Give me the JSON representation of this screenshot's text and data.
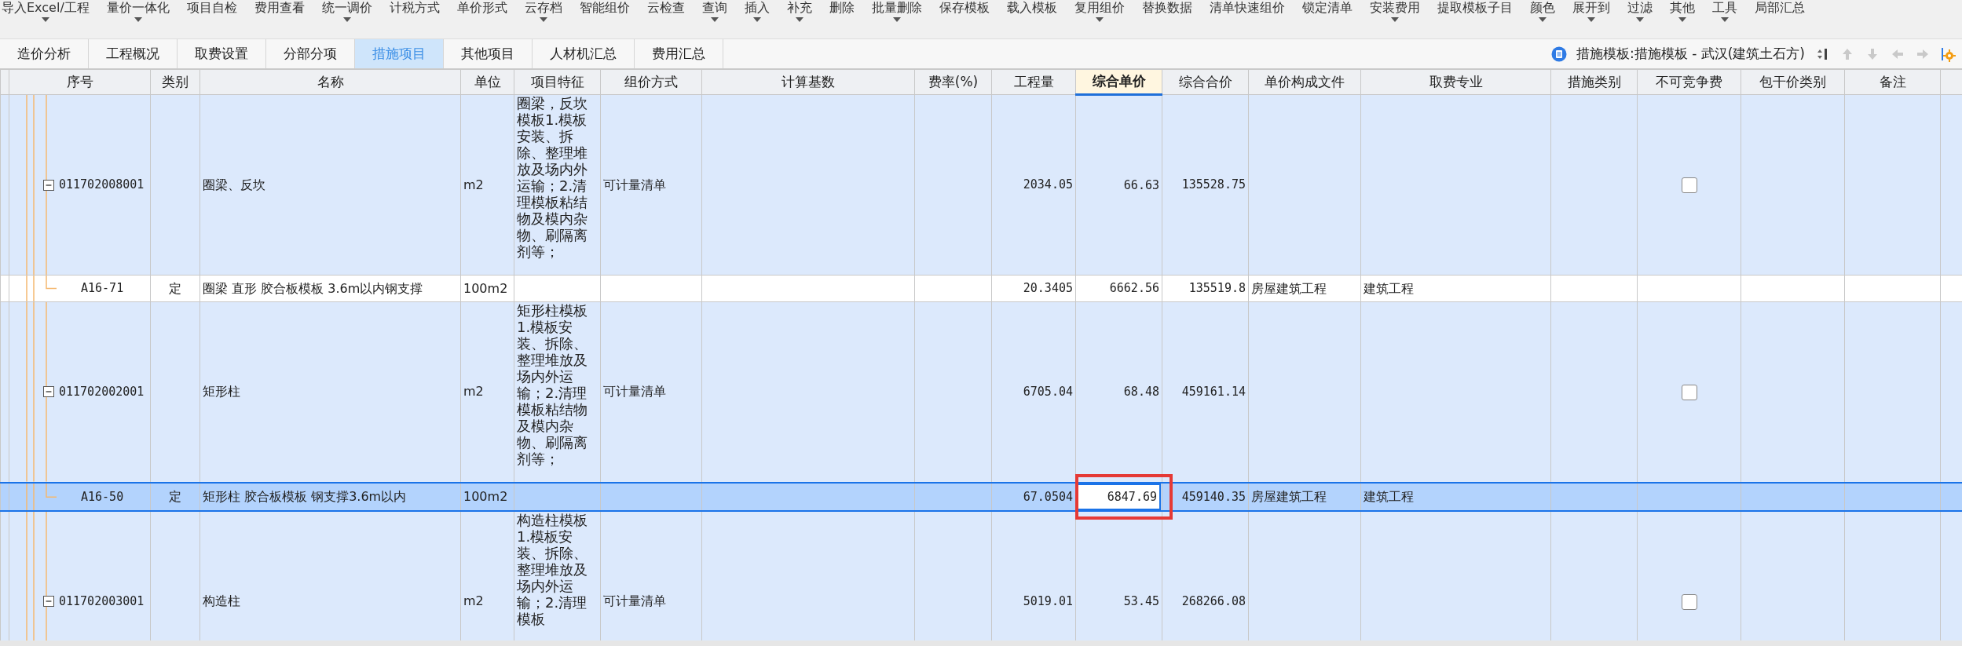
{
  "toolbar": [
    {
      "label": "导入Excel/工程",
      "dropdown": true
    },
    {
      "label": "量价一体化",
      "dropdown": true
    },
    {
      "label": "项目自检",
      "dropdown": false
    },
    {
      "label": "费用查看",
      "dropdown": false
    },
    {
      "label": "统一调价",
      "dropdown": true
    },
    {
      "label": "计税方式",
      "dropdown": false
    },
    {
      "label": "单价形式",
      "dropdown": false
    },
    {
      "label": "云存档",
      "dropdown": true
    },
    {
      "label": "智能组价",
      "dropdown": false
    },
    {
      "label": "云检查",
      "dropdown": false
    },
    {
      "label": "查询",
      "dropdown": true
    },
    {
      "label": "插入",
      "dropdown": true
    },
    {
      "label": "补充",
      "dropdown": true
    },
    {
      "label": "删除",
      "dropdown": false
    },
    {
      "label": "批量删除",
      "dropdown": true
    },
    {
      "label": "保存模板",
      "dropdown": false
    },
    {
      "label": "载入模板",
      "dropdown": false
    },
    {
      "label": "复用组价",
      "dropdown": true
    },
    {
      "label": "替换数据",
      "dropdown": false
    },
    {
      "label": "清单快速组价",
      "dropdown": false
    },
    {
      "label": "锁定清单",
      "dropdown": false
    },
    {
      "label": "安装费用",
      "dropdown": true
    },
    {
      "label": "提取模板子目",
      "dropdown": false
    },
    {
      "label": "颜色",
      "dropdown": true
    },
    {
      "label": "展开到",
      "dropdown": true
    },
    {
      "label": "过滤",
      "dropdown": true
    },
    {
      "label": "其他",
      "dropdown": true
    },
    {
      "label": "工具",
      "dropdown": true
    },
    {
      "label": "局部汇总",
      "dropdown": false
    }
  ],
  "tabs": [
    {
      "label": "造价分析",
      "selected": false
    },
    {
      "label": "工程概况",
      "selected": false
    },
    {
      "label": "取费设置",
      "selected": false
    },
    {
      "label": "分部分项",
      "selected": false
    },
    {
      "label": "措施项目",
      "selected": true
    },
    {
      "label": "其他项目",
      "selected": false
    },
    {
      "label": "人材机汇总",
      "selected": false
    },
    {
      "label": "费用汇总",
      "selected": false
    }
  ],
  "template": {
    "label": "措施模板:措施模板 - 武汉(建筑土石方)"
  },
  "table": {
    "columns": [
      {
        "label": "序号",
        "selected": false
      },
      {
        "label": "类别",
        "selected": false
      },
      {
        "label": "名称",
        "selected": false
      },
      {
        "label": "单位",
        "selected": false
      },
      {
        "label": "项目特征",
        "selected": false
      },
      {
        "label": "组价方式",
        "selected": false
      },
      {
        "label": "计算基数",
        "selected": false
      },
      {
        "label": "费率(%)",
        "selected": false
      },
      {
        "label": "工程量",
        "selected": false
      },
      {
        "label": "综合单价",
        "selected": true
      },
      {
        "label": "综合合价",
        "selected": false
      },
      {
        "label": "单价构成文件",
        "selected": false
      },
      {
        "label": "取费专业",
        "selected": false
      },
      {
        "label": "措施类别",
        "selected": false
      },
      {
        "label": "不可竞争费",
        "selected": false
      },
      {
        "label": "包干价类别",
        "selected": false
      },
      {
        "label": "备注",
        "selected": false
      }
    ],
    "rows": [
      {
        "kind": "list",
        "expanded": true,
        "selected": false,
        "code": "011702008001",
        "name": "圈梁、反坎",
        "unit": "m2",
        "features": "圈梁，反坎模板1.模板安装、拆除、整理堆放及场内外运输；2.清理模板粘结物及模内杂物、刷隔离剂等；",
        "method": "可计量清单",
        "quantity": "2034.05",
        "unit_price": "66.63",
        "total": "135528.75",
        "non_competitive": false
      },
      {
        "kind": "item",
        "selected": false,
        "code": "A16-71",
        "category": "定",
        "name": "圈梁 直形 胶合板模板 3.6m以内钢支撑",
        "unit": "100m2",
        "quantity": "20.3405",
        "unit_price": "6662.56",
        "total": "135519.8",
        "price_file": "房屋建筑工程",
        "fee_major": "建筑工程"
      },
      {
        "kind": "list",
        "expanded": true,
        "selected": false,
        "code": "011702002001",
        "name": "矩形柱",
        "unit": "m2",
        "features": "矩形柱模板1.模板安装、拆除、整理堆放及场内外运输；2.清理模板粘结物及模内杂物、刷隔离剂等；",
        "method": "可计量清单",
        "quantity": "6705.04",
        "unit_price": "68.48",
        "total": "459161.14",
        "non_competitive": false
      },
      {
        "kind": "item",
        "selected": true,
        "editing": true,
        "annotated": true,
        "code": "A16-50",
        "category": "定",
        "name": "矩形柱 胶合板模板 钢支撑3.6m以内",
        "unit": "100m2",
        "quantity": "67.0504",
        "unit_price": "6847.69",
        "total": "459140.35",
        "price_file": "房屋建筑工程",
        "fee_major": "建筑工程"
      },
      {
        "kind": "list",
        "expanded": true,
        "selected": false,
        "code": "011702003001",
        "name": "构造柱",
        "unit": "m2",
        "features": "构造柱模板1.模板安装、拆除、整理堆放及场内外运输；2.清理模板",
        "method": "可计量清单",
        "quantity": "5019.01",
        "unit_price": "53.45",
        "total": "268266.08",
        "non_competitive": false
      }
    ]
  }
}
